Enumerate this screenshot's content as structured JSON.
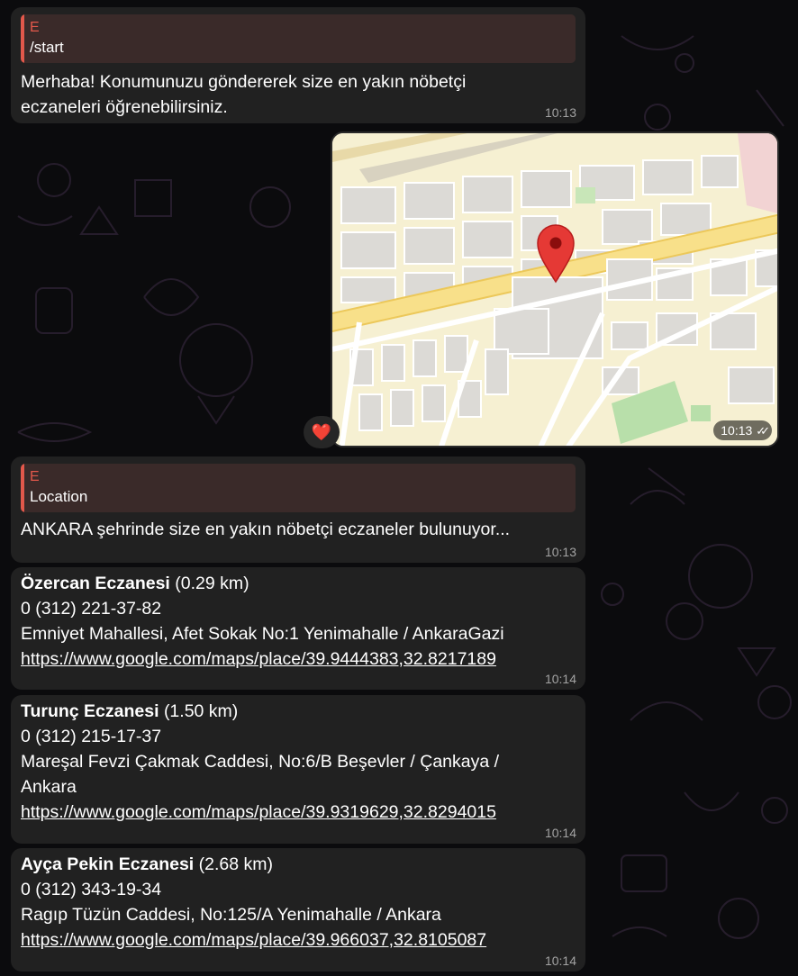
{
  "messages": {
    "m1": {
      "reply_name": "E",
      "reply_text": "/start",
      "text": "Merhaba! Konumunuzu göndererek size en yakın nöbetçi eczaneleri öğrenebilirsiniz.",
      "time": "10:13"
    },
    "location": {
      "time": "10:13",
      "reaction": "❤️"
    },
    "m2": {
      "reply_name": "E",
      "reply_text": "Location",
      "text": "ANKARA şehrinde size en yakın nöbetçi eczaneler bulunuyor...",
      "time": "10:13"
    }
  },
  "pharmacies": [
    {
      "name": "Özercan Eczanesi",
      "distance": "(0.29 km)",
      "phone": "0 (312) 221-37-82",
      "address": "Emniyet Mahallesi, Afet Sokak No:1 Yenimahalle / AnkaraGazi",
      "url": "https://www.google.com/maps/place/39.9444383,32.8217189",
      "time": "10:14"
    },
    {
      "name": "Turunç Eczanesi",
      "distance": "(1.50 km)",
      "phone": "0 (312) 215-17-37",
      "address": "Mareşal Fevzi Çakmak Caddesi, No:6/B Beşevler / Çankaya / Ankara",
      "url": "https://www.google.com/maps/place/39.9319629,32.8294015",
      "time": "10:14"
    },
    {
      "name": "Ayça Pekin Eczanesi",
      "distance": "(2.68 km)",
      "phone": "0 (312) 343-19-34",
      "address": "Ragıp Tüzün Caddesi, No:125/A Yenimahalle / Ankara",
      "url": "https://www.google.com/maps/place/39.966037,32.8105087",
      "time": "10:14"
    }
  ]
}
